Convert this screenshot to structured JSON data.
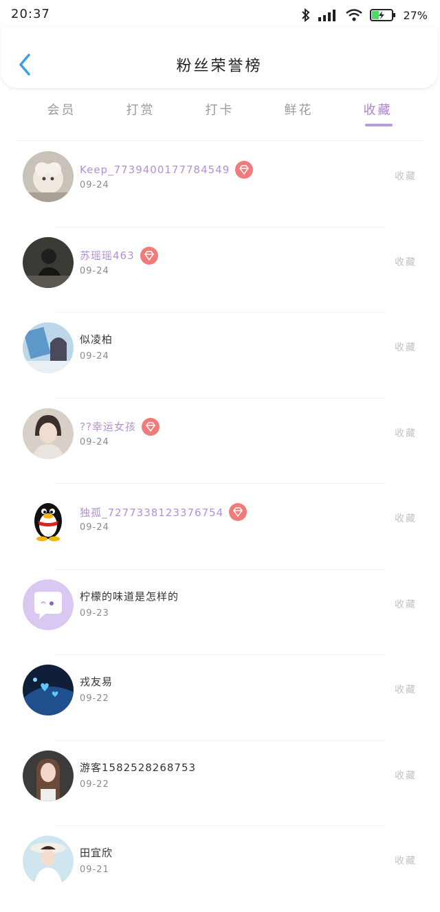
{
  "status": {
    "time": "20:37",
    "battery_text": "27%"
  },
  "header": {
    "title": "粉丝荣誉榜"
  },
  "tabs": [
    {
      "label": "会员",
      "active": false
    },
    {
      "label": "打赏",
      "active": false
    },
    {
      "label": "打卡",
      "active": false
    },
    {
      "label": "鲜花",
      "active": false
    },
    {
      "label": "收藏",
      "active": true
    }
  ],
  "rows": [
    {
      "name": "Keep_7739400177784549",
      "date": "09-24",
      "tag": "收藏",
      "badge": true,
      "avatar": "sheep-plush"
    },
    {
      "name": "苏瑶瑶463",
      "date": "09-24",
      "tag": "收藏",
      "badge": true,
      "avatar": "person-dark"
    },
    {
      "name": "似凌柏",
      "date": "09-24",
      "tag": "收藏",
      "badge": false,
      "avatar": "anime-blue"
    },
    {
      "name": "??幸运女孩",
      "date": "09-24",
      "tag": "收藏",
      "badge": true,
      "avatar": "person-portrait"
    },
    {
      "name": "独孤_7277338123376754",
      "date": "09-24",
      "tag": "收藏",
      "badge": true,
      "avatar": "qq-penguin"
    },
    {
      "name": "柠檬的味道是怎样的",
      "date": "09-23",
      "tag": "收藏",
      "badge": false,
      "avatar": "chat-bubble"
    },
    {
      "name": "戎友易",
      "date": "09-22",
      "tag": "收藏",
      "badge": false,
      "avatar": "blue-hearts"
    },
    {
      "name": "游客1582528268753",
      "date": "09-22",
      "tag": "收藏",
      "badge": false,
      "avatar": "girl-photo"
    },
    {
      "name": "田宜欣",
      "date": "09-21",
      "tag": "收藏",
      "badge": false,
      "avatar": "girl-hat"
    }
  ],
  "colors": {
    "accent": "#a883d1",
    "badge": "#f07b7b",
    "vip_name": "#b48fd6"
  }
}
